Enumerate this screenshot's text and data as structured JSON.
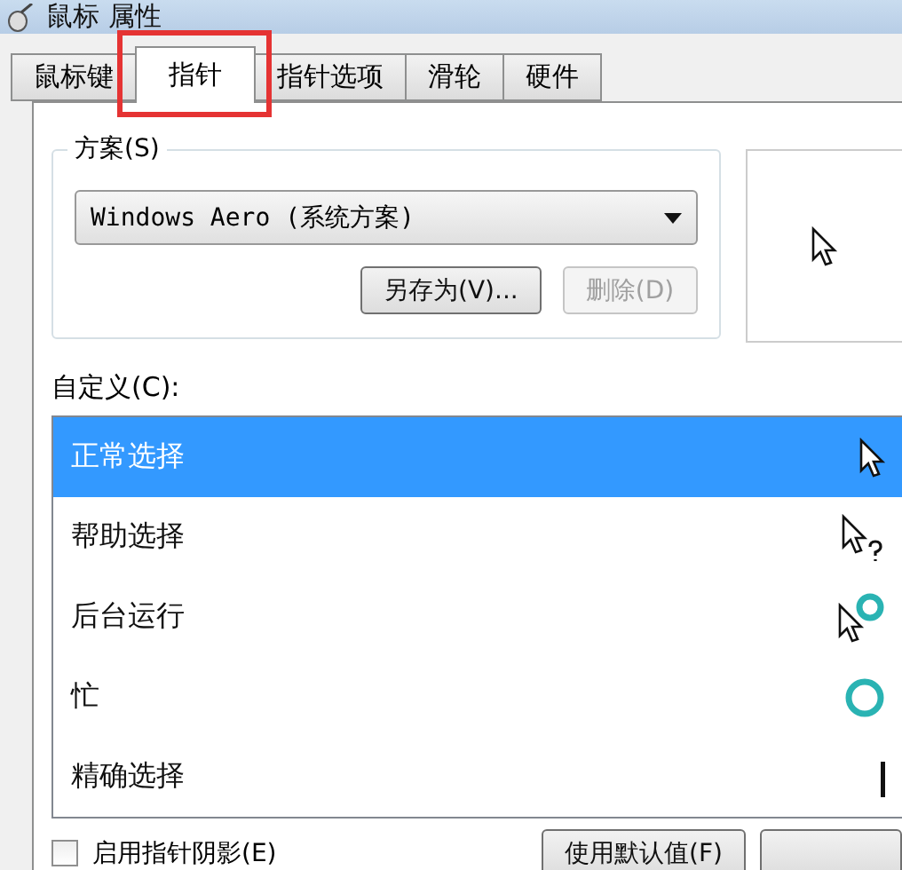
{
  "window": {
    "title": "鼠标 属性"
  },
  "tabs": [
    {
      "label": "鼠标键",
      "selected": false
    },
    {
      "label": "指针",
      "selected": true,
      "highlighted": true
    },
    {
      "label": "指针选项",
      "selected": false
    },
    {
      "label": "滑轮",
      "selected": false
    },
    {
      "label": "硬件",
      "selected": false
    }
  ],
  "scheme": {
    "label": "方案(S)",
    "value": "Windows Aero (系统方案)",
    "buttons": [
      {
        "label": "另存为(V)...",
        "disabled": false
      },
      {
        "label": "删除(D)",
        "disabled": true
      }
    ]
  },
  "preview": {
    "kind": "arrow"
  },
  "customize": {
    "label": "自定义(C):",
    "items": [
      {
        "name": "正常选择",
        "kind": "arrow",
        "selected": true
      },
      {
        "name": "帮助选择",
        "kind": "help",
        "selected": false
      },
      {
        "name": "后台运行",
        "kind": "working",
        "selected": false
      },
      {
        "name": "忙",
        "kind": "busy",
        "selected": false
      },
      {
        "name": "精确选择",
        "kind": "beam",
        "selected": false
      }
    ]
  },
  "shadow": {
    "label": "启用指针阴影(E)",
    "checked": false
  },
  "footer_buttons": [
    {
      "kind": "labeled",
      "label": "使用默认值(F)"
    },
    {
      "kind": "blank"
    }
  ]
}
